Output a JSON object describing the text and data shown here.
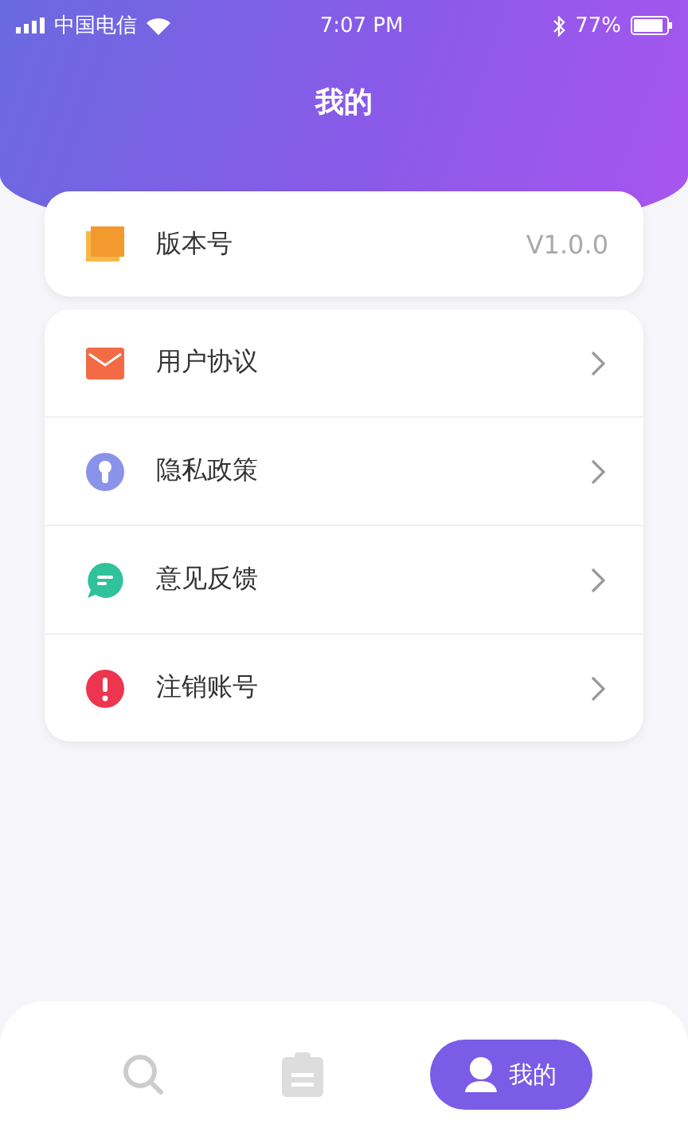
{
  "status_bar": {
    "carrier": "中国电信",
    "time": "7:07 PM",
    "battery": "77%"
  },
  "title": "我的",
  "version": {
    "label": "版本号",
    "value": "V1.0.0"
  },
  "menu": [
    {
      "kind": "mail",
      "label": "用户协议"
    },
    {
      "kind": "lock",
      "label": "隐私政策"
    },
    {
      "kind": "chat",
      "label": "意见反馈"
    },
    {
      "kind": "alert",
      "label": "注销账号"
    }
  ],
  "tab_bar": [
    {
      "kind": "search",
      "selected": false
    },
    {
      "kind": "clipboard",
      "selected": false
    },
    {
      "kind": "profile",
      "label": "我的",
      "selected": true
    }
  ]
}
